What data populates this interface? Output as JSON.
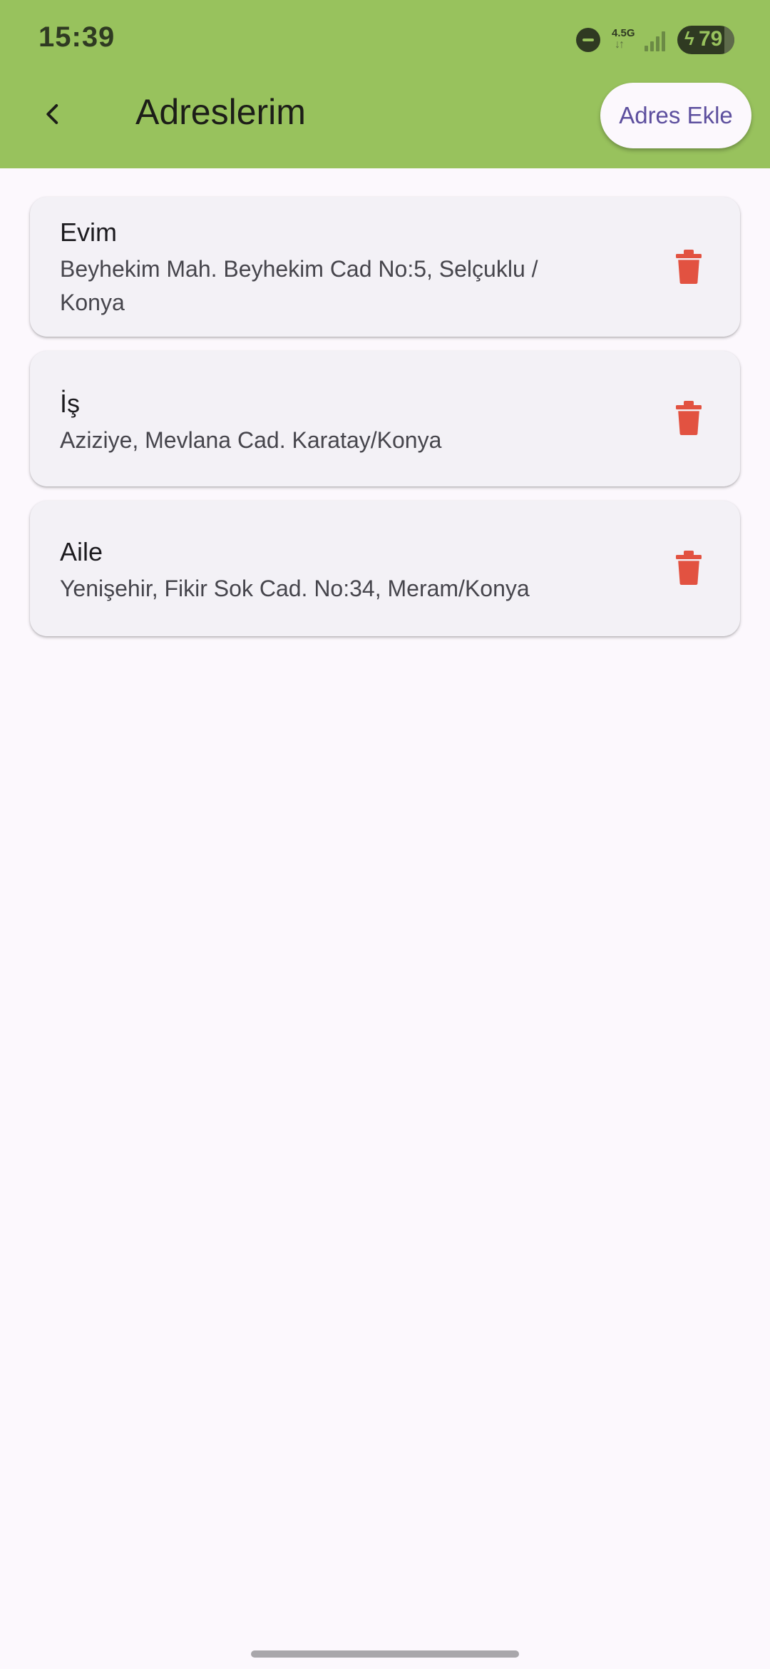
{
  "status_bar": {
    "time": "15:39",
    "network_type": "4.5G",
    "battery_level": "79",
    "icons": [
      "do-not-disturb-icon",
      "network-4-5g-icon",
      "signal-icon",
      "battery-charging-icon"
    ]
  },
  "app_bar": {
    "title": "Adreslerim",
    "back_icon": "back-arrow-icon",
    "add_button_label": "Adres Ekle",
    "background_color": "#98c25d",
    "accent_color": "#5d4f9e"
  },
  "addresses": [
    {
      "title": "Evim",
      "address": "Beyhekim Mah. Beyhekim Cad No:5, Selçuklu / Konya",
      "delete_icon": "trash-icon"
    },
    {
      "title": "İş",
      "address": "Aziziye, Mevlana Cad. Karatay/Konya",
      "delete_icon": "trash-icon"
    },
    {
      "title": "Aile",
      "address": "Yenişehir, Fikir Sok Cad. No:34, Meram/Konya",
      "delete_icon": "trash-icon"
    }
  ],
  "colors": {
    "delete": "#e25241",
    "background": "#fcf8fd",
    "card": "#f3f1f6"
  }
}
